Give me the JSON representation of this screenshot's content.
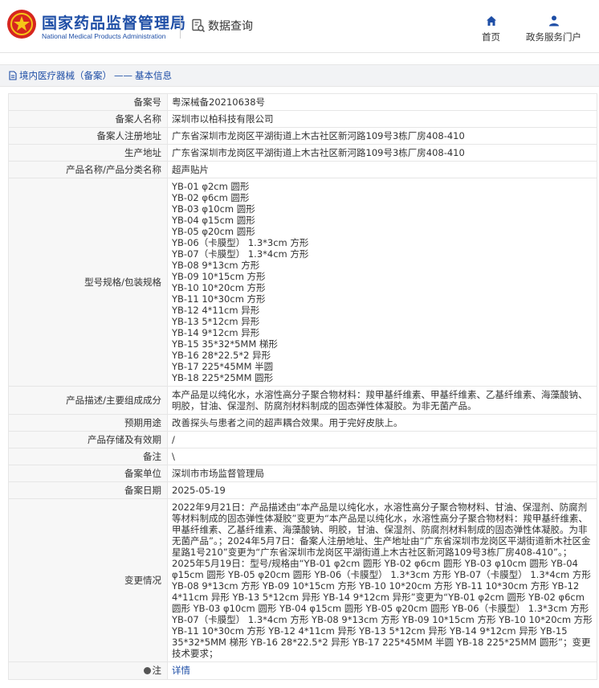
{
  "header": {
    "brand_cn": "国家药品监督管理局",
    "brand_en": "National Medical Products Administration",
    "query_label": "数据查询",
    "nav": [
      {
        "label": "首页",
        "icon": "home-icon"
      },
      {
        "label": "政务服务门户",
        "icon": "user-icon"
      }
    ],
    "brand_color": "#1e4ea6",
    "logo_color": "#d6261f"
  },
  "breadcrumb": {
    "section": "境内医疗器械（备案）",
    "separator": "——",
    "current": "基本信息"
  },
  "record": {
    "rows": [
      {
        "key": "备案号",
        "value": "粤深械备20210638号"
      },
      {
        "key": "备案人名称",
        "value": "深圳市以柏科技有限公司"
      },
      {
        "key": "备案人注册地址",
        "value": "广东省深圳市龙岗区平湖街道上木古社区新河路109号3栋厂房408-410"
      },
      {
        "key": "生产地址",
        "value": "广东省深圳市龙岗区平湖街道上木古社区新河路109号3栋厂房408-410"
      },
      {
        "key": "产品名称/产品分类名称",
        "value": "超声贴片"
      }
    ],
    "model_key": "型号规格/包装规格",
    "models": [
      "YB-01 φ2cm 圆形",
      "YB-02 φ6cm 圆形",
      "YB-03 φ10cm 圆形",
      "YB-04 φ15cm 圆形",
      "YB-05 φ20cm 圆形",
      "YB-06（卡膜型） 1.3*3cm 方形",
      "YB-07（卡膜型） 1.3*4cm 方形",
      "YB-08 9*13cm 方形",
      "YB-09 10*15cm 方形",
      "YB-10 10*20cm 方形",
      "YB-11 10*30cm 方形",
      "YB-12 4*11cm 异形",
      "YB-13 5*12cm 异形",
      "YB-14 9*12cm 异形",
      "YB-15 35*32*5MM 梯形",
      "YB-16 28*22.5*2 异形",
      "YB-17 225*45MM 半圆",
      "YB-18 225*25MM 圆形"
    ],
    "rows2": [
      {
        "key": "产品描述/主要组成成分",
        "value": "本产品是以纯化水，水溶性高分子聚合物材料：羧甲基纤维素、甲基纤维素、乙基纤维素、海藻酸钠、明胶，甘油、保湿剂、防腐剂材料制成的固态弹性体凝胶。为非无菌产品。"
      },
      {
        "key": "预期用途",
        "value": "改善探头与患者之间的超声耦合效果。用于完好皮肤上。"
      },
      {
        "key": "产品存储及有效期",
        "value": "/"
      },
      {
        "key": "备注",
        "value": "\\"
      },
      {
        "key": "备案单位",
        "value": "深圳市市场监督管理局"
      },
      {
        "key": "备案日期",
        "value": "2025-05-19"
      },
      {
        "key": "变更情况",
        "value": "2022年9月21日：产品描述由“本产品是以纯化水，水溶性高分子聚合物材料、甘油、保湿剂、防腐剂等材料制成的固态弹性体凝胶”变更为“本产品是以纯化水，水溶性高分子聚合物材料：羧甲基纤维素、甲基纤维素、乙基纤维素、海藻酸钠、明胶，甘油、保湿剂、防腐剂材料制成的固态弹性体凝胶。为非无菌产品”。；2024年5月7日：备案人注册地址、生产地址由“广东省深圳市龙岗区平湖街道新木社区金星路1号210”变更为“广东省深圳市龙岗区平湖街道上木古社区新河路109号3栋厂房408-410”。；2025年5月19日：型号/规格由“YB-01 φ2cm 圆形 YB-02 φ6cm 圆形 YB-03 φ10cm 圆形 YB-04 φ15cm 圆形 YB-05 φ20cm 圆形 YB-06（卡膜型） 1.3*3cm 方形 YB-07（卡膜型） 1.3*4cm 方形 YB-08 9*13cm 方形 YB-09 10*15cm 方形 YB-10 10*20cm 方形 YB-11 10*30cm 方形 YB-12 4*11cm 异形 YB-13 5*12cm 异形 YB-14 9*12cm 异形”变更为“YB-01 φ2cm 圆形 YB-02 φ6cm 圆形 YB-03 φ10cm 圆形 YB-04 φ15cm 圆形 YB-05 φ20cm 圆形 YB-06（卡膜型） 1.3*3cm 方形 YB-07（卡膜型） 1.3*4cm 方形 YB-08 9*13cm 方形 YB-09 10*15cm 方形 YB-10 10*20cm 方形 YB-11 10*30cm 方形 YB-12 4*11cm 异形 YB-13 5*12cm 异形 YB-14 9*12cm 异形 YB-15 35*32*5MM 梯形 YB-16 28*22.5*2 异形 YB-17 225*45MM 半圆 YB-18 225*25MM 圆形”；变更技术要求；"
      }
    ],
    "note": {
      "key": "注",
      "icon": "info-dot-icon",
      "link": "详情"
    }
  }
}
